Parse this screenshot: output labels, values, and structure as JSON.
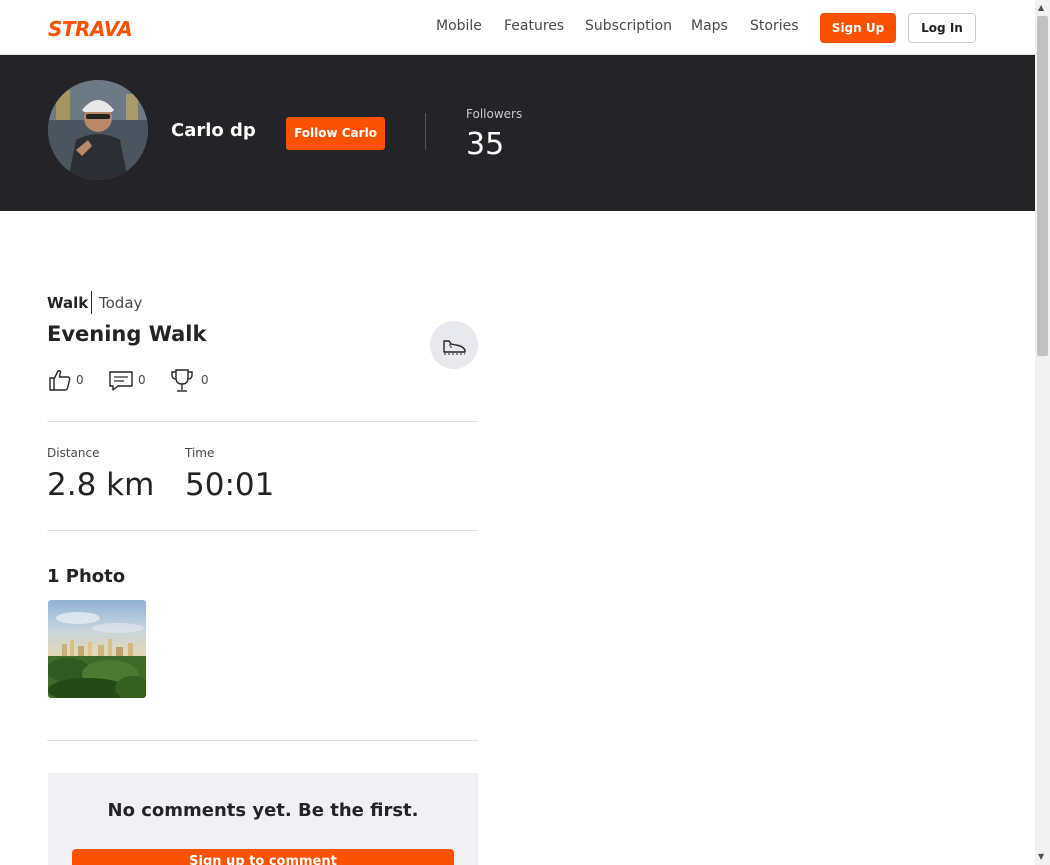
{
  "brand": {
    "logo": "STRAVA",
    "accent": "#fc5200"
  },
  "nav": {
    "items": [
      "Mobile",
      "Features",
      "Subscription",
      "Maps",
      "Stories"
    ],
    "signup_label": "Sign Up",
    "login_label": "Log In"
  },
  "athlete": {
    "name": "Carlo dp",
    "follow_label": "Follow Carlo",
    "followers_label": "Followers",
    "followers_count": "35"
  },
  "activity": {
    "type": "Walk",
    "date": "Today",
    "title": "Evening Walk",
    "sport_icon": "shoe-icon",
    "kudos_count": "0",
    "comments_count": "0",
    "achievements_count": "0",
    "stats": [
      {
        "label": "Distance",
        "value": "2.8 km"
      },
      {
        "label": "Time",
        "value": "50:01"
      }
    ],
    "photos_heading": "1 Photo"
  },
  "comments": {
    "empty_text": "No comments yet. Be the first.",
    "signup_label": "Sign up to comment"
  }
}
